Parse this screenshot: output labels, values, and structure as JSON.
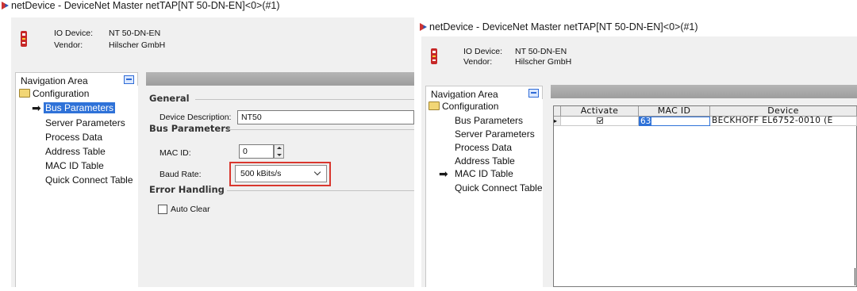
{
  "windows": [
    {
      "title": "netDevice - DeviceNet Master netTAP[NT 50-DN-EN]<0>(#1)",
      "header": {
        "io_device_label": "IO Device:",
        "io_device_value": "NT 50-DN-EN",
        "vendor_label": "Vendor:",
        "vendor_value": "Hilscher GmbH"
      },
      "nav": {
        "title": "Navigation Area",
        "root": "Configuration",
        "items": [
          "Bus Parameters",
          "Server Parameters",
          "Process Data",
          "Address Table",
          "MAC ID Table",
          "Quick Connect Table"
        ],
        "selected": "Bus Parameters"
      },
      "form": {
        "general_title": "General",
        "device_description_label": "Device Description:",
        "device_description_value": "NT50",
        "bus_parameters_title": "Bus Parameters",
        "mac_id_label": "MAC ID:",
        "mac_id_value": "0",
        "baud_rate_label": "Baud Rate:",
        "baud_rate_value": "500 kBits/s",
        "error_handling_title": "Error Handling",
        "auto_clear_label": "Auto Clear",
        "auto_clear_checked": false
      }
    },
    {
      "title": "netDevice - DeviceNet Master netTAP[NT 50-DN-EN]<0>(#1)",
      "header": {
        "io_device_label": "IO Device:",
        "io_device_value": "NT 50-DN-EN",
        "vendor_label": "Vendor:",
        "vendor_value": "Hilscher GmbH"
      },
      "nav": {
        "title": "Navigation Area",
        "root": "Configuration",
        "items": [
          "Bus Parameters",
          "Server Parameters",
          "Process Data",
          "Address Table",
          "MAC ID Table",
          "Quick Connect Table"
        ],
        "selected": "MAC ID Table"
      },
      "table": {
        "columns": [
          "Activate",
          "MAC ID",
          "Device"
        ],
        "rows": [
          {
            "activate": true,
            "mac_id": "63",
            "device": "BECKHOFF EL6752-0010 (E"
          }
        ]
      }
    }
  ],
  "colors": {
    "selection": "#2f72d8",
    "highlight_box": "#d9372e",
    "banner": "#a8a8a8"
  }
}
